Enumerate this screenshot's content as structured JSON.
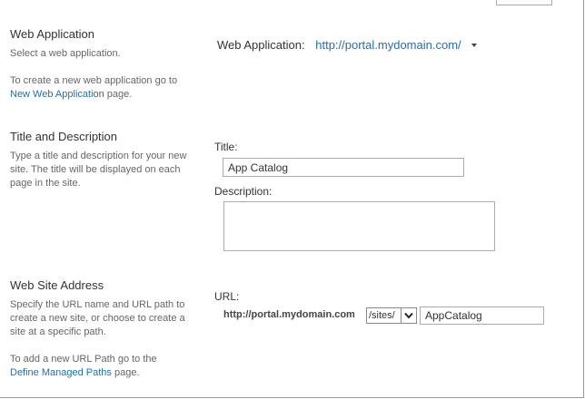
{
  "web_application": {
    "title": "Web Application",
    "desc_line1": "Select a web application.",
    "desc_line2_pre": "To create a new web application go to",
    "desc_link": "New Web Application",
    "desc_line2_post": " page.",
    "field_label": "Web Application:",
    "selected_value": "http://portal.mydomain.com/"
  },
  "title_description": {
    "title": "Title and Description",
    "desc": "Type a title and description for your new site. The title will be displayed on each page in the site.",
    "title_label": "Title:",
    "title_value": "App Catalog",
    "description_label": "Description:",
    "description_value": ""
  },
  "web_site_address": {
    "title": "Web Site Address",
    "desc_line1": "Specify the URL name and URL path to create a new site, or choose to create a site at a specific path.",
    "desc_line2_pre": "To add a new URL Path go to the",
    "desc_link": "Define Managed Paths",
    "desc_line2_post": " page.",
    "url_label": "URL:",
    "url_prefix": "http://portal.mydomain.com",
    "path_selected": "/sites/",
    "url_name_value": "AppCatalog"
  },
  "icons": {
    "webapp_dropdown": "chevron-down-icon",
    "path_dropdown": "chevron-down-icon"
  },
  "colors": {
    "link": "#1e6fb5",
    "text": "#444444",
    "border": "#ababab"
  }
}
